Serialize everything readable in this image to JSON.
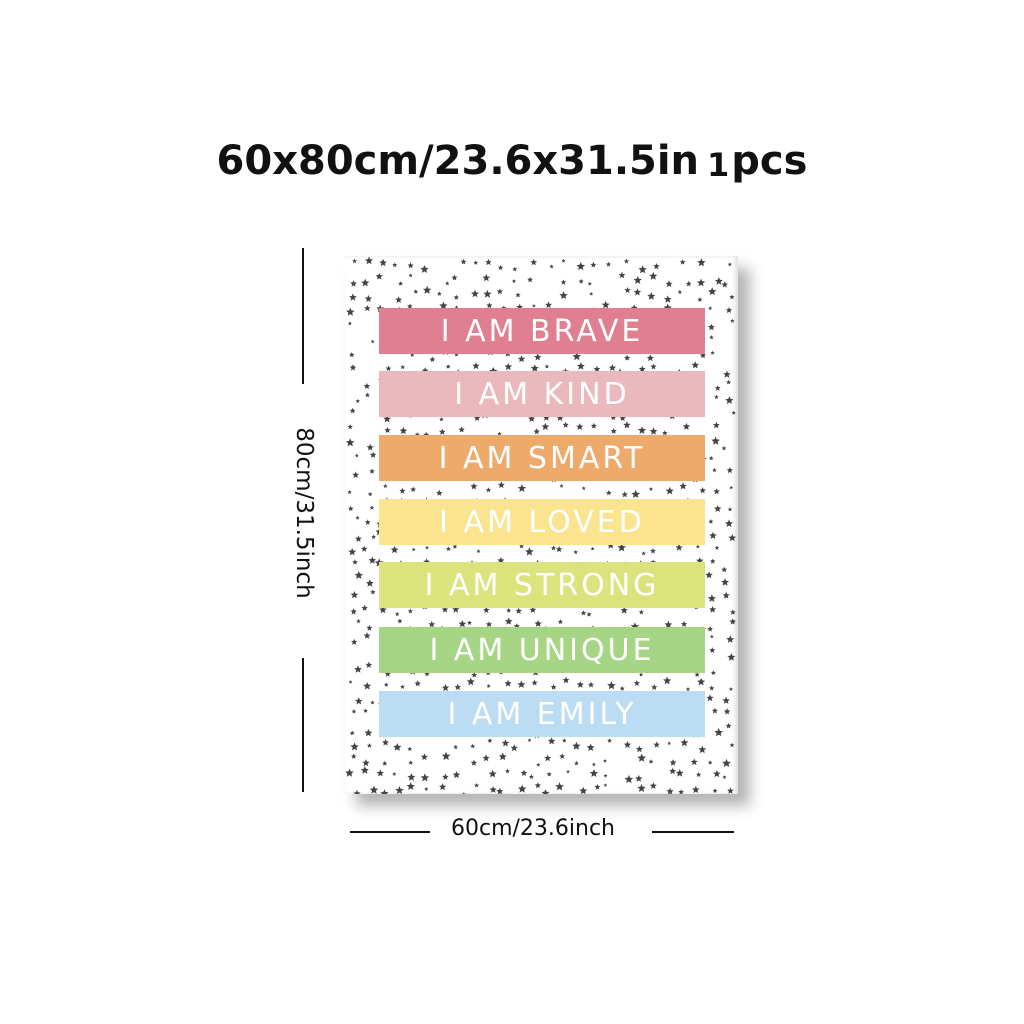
{
  "header": {
    "size_text": "60x80cm/23.6x31.5in",
    "quantity_number": "1",
    "quantity_unit": "pcs"
  },
  "poster": {
    "background": "#ffffff",
    "star_color": "#444444",
    "bands": [
      {
        "text": "I AM BRAVE",
        "color": "#e07f8f"
      },
      {
        "text": "I AM KIND",
        "color": "#ebb8bd"
      },
      {
        "text": "I AM SMART",
        "color": "#eeaa6b"
      },
      {
        "text": "I AM LOVED",
        "color": "#fbe48f"
      },
      {
        "text": "I AM STRONG",
        "color": "#dbe47c"
      },
      {
        "text": "I AM UNIQUE",
        "color": "#a6d586"
      },
      {
        "text": "I AM EMILY",
        "color": "#bcdcf3"
      }
    ]
  },
  "dimensions": {
    "height_label": "80cm/31.5inch",
    "width_label": "60cm/23.6inch"
  }
}
